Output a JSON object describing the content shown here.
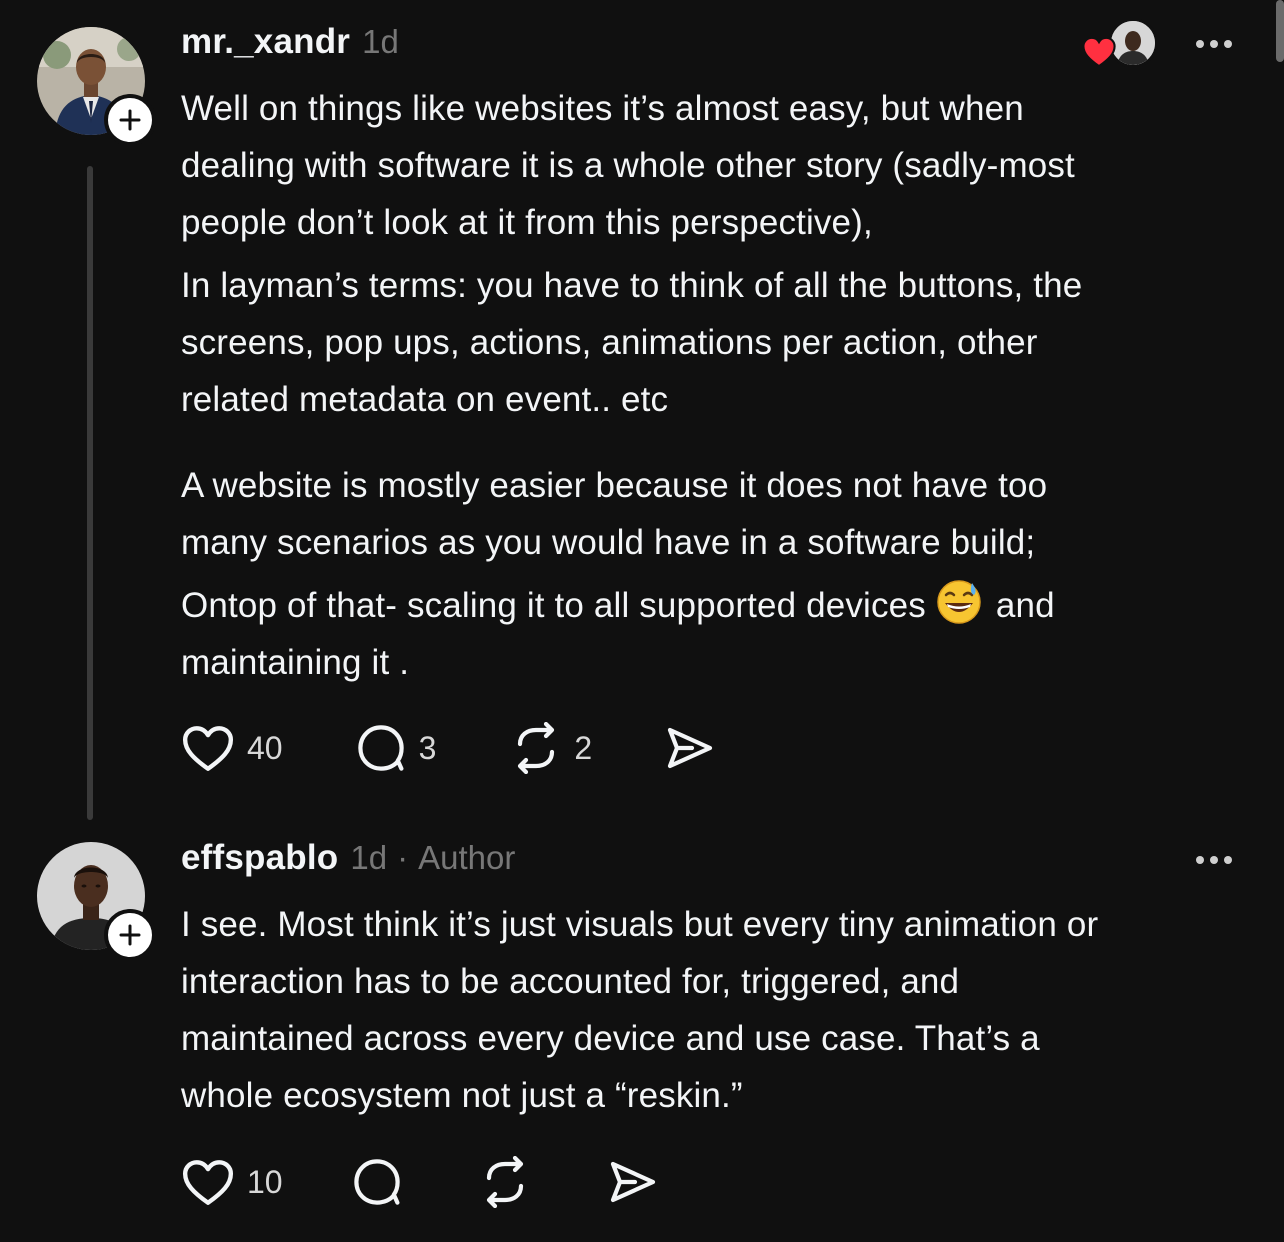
{
  "comments": [
    {
      "username": "mr._xandr",
      "time": "1d",
      "paragraphs": [
        [
          "Well on things like websites it’s almost easy, but when",
          "dealing with software it is a whole other story (sadly-most",
          "people don’t look at it from this perspective),"
        ],
        [
          "In layman’s terms: you have to think of all the buttons, the",
          "screens, pop ups, actions, animations per action, other",
          "related metadata on event.. etc"
        ],
        [
          "A website is mostly easier because it does not have too",
          "many scenarios as you would have in a software build;"
        ],
        [
          "Ontop of that- scaling it to all supported devices",
          "and",
          "maintaining it ."
        ]
      ],
      "emoji": "grinning-face-with-sweat-emoji",
      "likes": "40",
      "replies": "3",
      "reposts": "2",
      "liked_by_author": true
    },
    {
      "username": "effspablo",
      "time": "1d",
      "separator": "·",
      "badge": "Author",
      "lines": [
        "I see. Most think it’s just visuals but every tiny animation or",
        "interaction has to be accounted for, triggered, and",
        "maintained across every device and use case. That’s a",
        "whole ecosystem not just a “reskin.”"
      ],
      "likes": "10",
      "replies": "",
      "reposts": ""
    }
  ],
  "colors": {
    "background": "#101010",
    "text": "#f3f5f7",
    "muted": "#777777",
    "heart": "#ff3040",
    "thread_line": "#3a3a3a"
  }
}
